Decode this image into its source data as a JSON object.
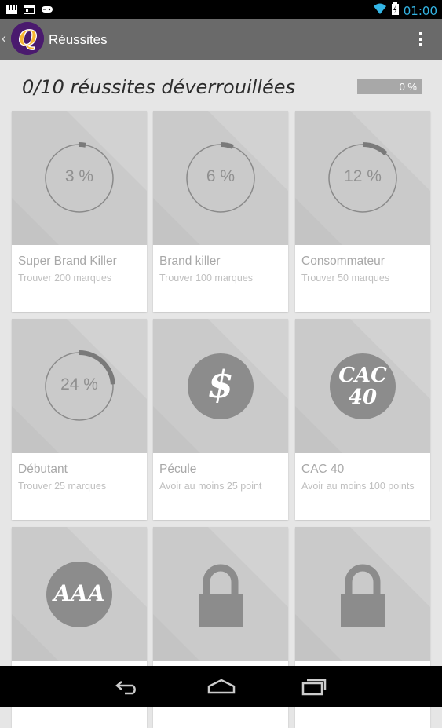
{
  "status_bar": {
    "time": "01:00",
    "icons": [
      "piano-icon",
      "calendar-icon",
      "gamepad-icon",
      "wifi-icon",
      "battery-icon"
    ]
  },
  "action_bar": {
    "back_icon": "chevron-left-icon",
    "logo_letter": "Q",
    "title": "Réussites",
    "menu_icon": "overflow-menu-icon"
  },
  "header": {
    "text": "0/10 réussites déverrouillées",
    "progress_label": "0 %",
    "progress_value": 0
  },
  "achievements": [
    {
      "title": "Super Brand Killer",
      "description": "Trouver 200 marques",
      "badge": "3 %",
      "progress": 0.03,
      "type": "progress"
    },
    {
      "title": "Brand killer",
      "description": "Trouver 100 marques",
      "badge": "6 %",
      "progress": 0.06,
      "type": "progress"
    },
    {
      "title": "Consommateur",
      "description": "Trouver 50 marques",
      "badge": "12 %",
      "progress": 0.12,
      "type": "progress"
    },
    {
      "title": "Débutant",
      "description": "Trouver 25 marques",
      "badge": "24 %",
      "progress": 0.24,
      "type": "progress"
    },
    {
      "title": "Pécule",
      "description": "Avoir au moins 25 point",
      "badge": "$",
      "type": "coin"
    },
    {
      "title": "CAC 40",
      "description": "Avoir au moins 100 points",
      "badge_line1": "CAC",
      "badge_line2": "40",
      "type": "coin"
    },
    {
      "badge": "AAA",
      "type": "coin"
    },
    {
      "type": "locked",
      "icon": "lock-icon"
    },
    {
      "type": "locked",
      "icon": "lock-icon"
    }
  ],
  "nav_bar": {
    "icons": [
      "back-icon",
      "home-icon",
      "recents-icon"
    ]
  },
  "colors": {
    "status_time": "#33b5e5",
    "action_bar": "#6a6a6a",
    "card_image_bg": "#c4c4c4"
  }
}
